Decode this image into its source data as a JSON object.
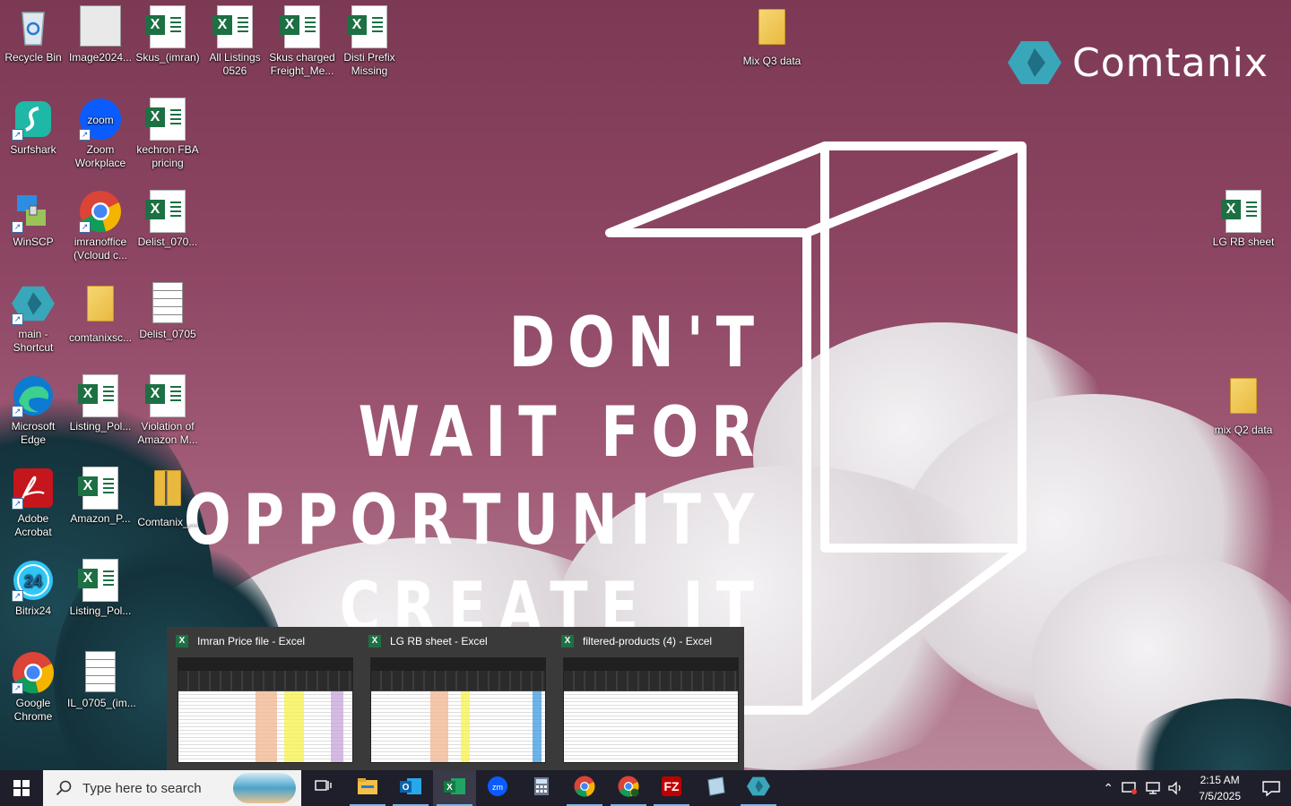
{
  "desktop": {
    "icons": [
      {
        "label": "Recycle Bin",
        "type": "recycle",
        "col": 0,
        "row": 0
      },
      {
        "label": "Image2024...",
        "type": "image",
        "col": 1,
        "row": 0
      },
      {
        "label": "Skus_(imran)",
        "type": "excel",
        "col": 2,
        "row": 0
      },
      {
        "label": "All Listings 0526",
        "type": "excel",
        "col": 3,
        "row": 0
      },
      {
        "label": "Skus charged Freight_Me...",
        "type": "excel",
        "col": 4,
        "row": 0
      },
      {
        "label": "Disti Prefix Missing",
        "type": "excel",
        "col": 5,
        "row": 0
      },
      {
        "label": "Mix Q3 data",
        "type": "folder",
        "col": 11,
        "row": 0
      },
      {
        "label": "Surfshark",
        "type": "surfshark",
        "col": 0,
        "row": 1,
        "shortcut": true
      },
      {
        "label": "Zoom Workplace",
        "type": "zoom",
        "col": 1,
        "row": 1,
        "shortcut": true
      },
      {
        "label": "kechron FBA pricing",
        "type": "excel",
        "col": 2,
        "row": 1
      },
      {
        "label": "WinSCP",
        "type": "winscp",
        "col": 0,
        "row": 2,
        "shortcut": true
      },
      {
        "label": "imranoffice (Vcloud c...",
        "type": "chrome",
        "col": 1,
        "row": 2,
        "shortcut": true
      },
      {
        "label": "Delist_070...",
        "type": "excel",
        "col": 2,
        "row": 2
      },
      {
        "label": "LG RB sheet",
        "type": "excel",
        "col": 18,
        "row": 2
      },
      {
        "label": "main - Shortcut",
        "type": "comtanix",
        "col": 0,
        "row": 3,
        "shortcut": true
      },
      {
        "label": "comtanixsc...",
        "type": "folder",
        "col": 1,
        "row": 3
      },
      {
        "label": "Delist_0705",
        "type": "doc",
        "col": 2,
        "row": 3
      },
      {
        "label": "Microsoft Edge",
        "type": "edge",
        "col": 0,
        "row": 4,
        "shortcut": true
      },
      {
        "label": "Listing_Pol...",
        "type": "excel",
        "col": 1,
        "row": 4
      },
      {
        "label": "Violation of Amazon M...",
        "type": "excel",
        "col": 2,
        "row": 4
      },
      {
        "label": "mix Q2 data",
        "type": "folder",
        "col": 18,
        "row": 4
      },
      {
        "label": "Adobe Acrobat",
        "type": "acrobat",
        "col": 0,
        "row": 5,
        "shortcut": true
      },
      {
        "label": "Amazon_P...",
        "type": "excel",
        "col": 1,
        "row": 5
      },
      {
        "label": "Comtanix_...",
        "type": "zipfolder",
        "col": 2,
        "row": 5
      },
      {
        "label": "Bitrix24",
        "type": "bitrix",
        "col": 0,
        "row": 6,
        "shortcut": true
      },
      {
        "label": "Listing_Pol...",
        "type": "excel",
        "col": 1,
        "row": 6
      },
      {
        "label": "Google Chrome",
        "type": "chrome",
        "col": 0,
        "row": 7,
        "shortcut": true
      },
      {
        "label": "IL_0705_(im...",
        "type": "doc",
        "col": 1,
        "row": 7
      }
    ]
  },
  "wallpaper": {
    "slogan_lines": [
      "DON'T",
      "WAIT FOR",
      "OPPORTUNITY",
      "CREATE IT"
    ],
    "brand": "Comtanix",
    "brand_color": "#3aa6b9"
  },
  "previews": [
    {
      "title": "Imran Price file - Excel"
    },
    {
      "title": "LG RB sheet - Excel"
    },
    {
      "title": "filtered-products (4) - Excel"
    }
  ],
  "taskbar": {
    "search_placeholder": "Type here to search",
    "apps": [
      {
        "name": "task-view",
        "active": false
      },
      {
        "name": "file-explorer",
        "active": true
      },
      {
        "name": "outlook",
        "active": true
      },
      {
        "name": "excel",
        "active": true,
        "selected": true
      },
      {
        "name": "zoom",
        "active": false
      },
      {
        "name": "calculator",
        "active": false
      },
      {
        "name": "chrome",
        "active": true
      },
      {
        "name": "chrome-profile",
        "active": true
      },
      {
        "name": "filezilla",
        "active": true
      },
      {
        "name": "notes",
        "active": false
      },
      {
        "name": "comtanix-app",
        "active": true
      }
    ],
    "time": "2:15 AM",
    "date": "7/5/2025"
  }
}
